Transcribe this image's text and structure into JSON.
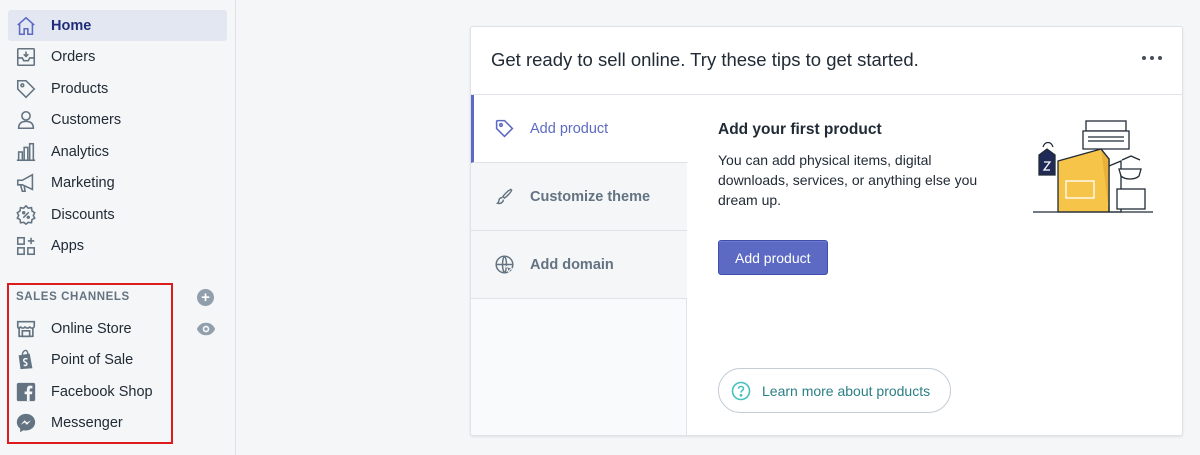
{
  "sidebar": {
    "items": [
      {
        "label": "Home",
        "icon": "home-icon"
      },
      {
        "label": "Orders",
        "icon": "orders-icon"
      },
      {
        "label": "Products",
        "icon": "tag-icon"
      },
      {
        "label": "Customers",
        "icon": "person-icon"
      },
      {
        "label": "Analytics",
        "icon": "bar-chart-icon"
      },
      {
        "label": "Marketing",
        "icon": "megaphone-icon"
      },
      {
        "label": "Discounts",
        "icon": "discount-icon"
      },
      {
        "label": "Apps",
        "icon": "apps-icon"
      }
    ],
    "channels_header": "SALES CHANNELS",
    "add_channel_symbol": "+",
    "channels": [
      {
        "label": "Online Store",
        "icon": "store-icon"
      },
      {
        "label": "Point of Sale",
        "icon": "shopify-bag-icon"
      },
      {
        "label": "Facebook Shop",
        "icon": "facebook-icon"
      },
      {
        "label": "Messenger",
        "icon": "messenger-icon"
      }
    ]
  },
  "card": {
    "title": "Get ready to sell online. Try these tips to get started.",
    "tabs": [
      {
        "label": "Add product",
        "icon": "tag-icon",
        "active": true
      },
      {
        "label": "Customize theme",
        "icon": "brush-icon",
        "active": false
      },
      {
        "label": "Add domain",
        "icon": "globe-icon",
        "active": false
      }
    ],
    "content": {
      "heading": "Add your first product",
      "body": "You can add physical items, digital downloads, services, or anything else you dream up.",
      "button": "Add product",
      "learn_more": "Learn more about products"
    }
  },
  "colors": {
    "accent": "#5c6ac4",
    "active_nav_text": "#202e78",
    "highlight_box": "#de1b1b",
    "learn_link": "#2b7f86",
    "illustration_yellow": "#f7c44a"
  }
}
